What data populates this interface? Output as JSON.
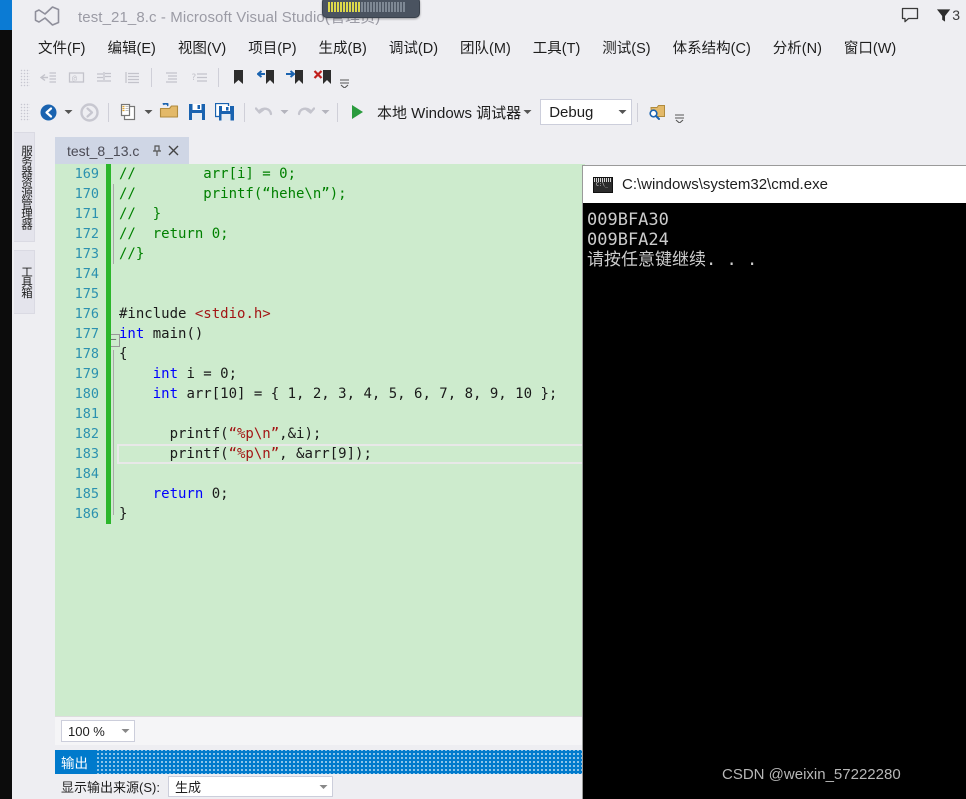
{
  "window": {
    "title": "test_21_8.c - Microsoft Visual Studio(管理员)",
    "logo_icon": "visual-studio-logo-icon",
    "perf_widget_icon": "performance-meter-icon",
    "feedback_icon": "feedback-bubble-icon",
    "notification_icon": "notification-funnel-icon",
    "notification_count": "3"
  },
  "menu": {
    "items": [
      {
        "label": "文件(F)"
      },
      {
        "label": "编辑(E)"
      },
      {
        "label": "视图(V)"
      },
      {
        "label": "项目(P)"
      },
      {
        "label": "生成(B)"
      },
      {
        "label": "调试(D)"
      },
      {
        "label": "团队(M)"
      },
      {
        "label": "工具(T)"
      },
      {
        "label": "测试(S)"
      },
      {
        "label": "体系结构(C)"
      },
      {
        "label": "分析(N)"
      },
      {
        "label": "窗口(W)"
      }
    ]
  },
  "toolbar_row1": {
    "icons": [
      {
        "name": "comment-selection-icon"
      },
      {
        "name": "uncomment-selection-icon"
      },
      {
        "name": "increase-indent-icon"
      },
      {
        "name": "decrease-indent-icon"
      },
      {
        "name": "format-document-icon"
      },
      {
        "name": "format-selection-icon"
      },
      {
        "name": "toggle-bookmark-icon"
      },
      {
        "name": "previous-bookmark-icon"
      },
      {
        "name": "next-bookmark-icon"
      },
      {
        "name": "clear-bookmarks-icon"
      },
      {
        "name": "toolbar-overflow-icon"
      }
    ]
  },
  "toolbar_row2": {
    "icons": [
      {
        "name": "navigate-backward-icon"
      },
      {
        "name": "navigate-backward-dropdown-icon"
      },
      {
        "name": "navigate-forward-icon"
      },
      {
        "name": "new-project-icon"
      },
      {
        "name": "new-project-dropdown-icon"
      },
      {
        "name": "open-file-icon"
      },
      {
        "name": "save-icon"
      },
      {
        "name": "save-all-icon"
      },
      {
        "name": "undo-icon"
      },
      {
        "name": "undo-dropdown-icon"
      },
      {
        "name": "redo-icon"
      },
      {
        "name": "redo-dropdown-icon"
      },
      {
        "name": "start-debug-icon"
      },
      {
        "name": "find-in-files-icon"
      },
      {
        "name": "toolbar-overflow-icon"
      }
    ],
    "start_label": "本地 Windows 调试器",
    "configuration": "Debug"
  },
  "left_dock": {
    "tabs": [
      {
        "label": "服务器资源管理器"
      },
      {
        "label": "工具箱"
      }
    ]
  },
  "document_tab": {
    "name": "test_8_13.c",
    "pin_icon": "pin-icon",
    "close_icon": "close-icon"
  },
  "editor": {
    "zoom": "100 %",
    "lines": [
      {
        "n": "169",
        "changed": true,
        "html": "<span class='cmt'>//        arr[i] = 0;</span>"
      },
      {
        "n": "170",
        "changed": true,
        "html": "<span class='cmt'>//        printf(“hehe\\n”);</span>"
      },
      {
        "n": "171",
        "changed": true,
        "html": "<span class='cmt'>//  }</span>"
      },
      {
        "n": "172",
        "changed": true,
        "html": "<span class='cmt'>//  return 0;</span>"
      },
      {
        "n": "173",
        "changed": true,
        "html": "<span class='cmt'>//}</span>"
      },
      {
        "n": "174",
        "changed": true,
        "html": ""
      },
      {
        "n": "175",
        "changed": true,
        "html": ""
      },
      {
        "n": "176",
        "changed": true,
        "html": "<span class='pp'>#include</span> <span class='inc'>&lt;stdio.h&gt;</span>"
      },
      {
        "n": "177",
        "changed": true,
        "html": "<span class='kw'>int</span> main()"
      },
      {
        "n": "178",
        "changed": true,
        "html": "{"
      },
      {
        "n": "179",
        "changed": true,
        "html": "    <span class='kw'>int</span> i = 0;"
      },
      {
        "n": "180",
        "changed": true,
        "html": "    <span class='kw'>int</span> arr[10] = { 1, 2, 3, 4, 5, 6, 7, 8, 9, 10 };"
      },
      {
        "n": "181",
        "changed": true,
        "html": ""
      },
      {
        "n": "182",
        "changed": true,
        "html": "      printf(<span class='str'>“%p\\n”</span>,&amp;i);"
      },
      {
        "n": "183",
        "changed": true,
        "html": "      printf(<span class='str'>“%p\\n”</span>, &amp;arr[9]);"
      },
      {
        "n": "184",
        "changed": true,
        "html": ""
      },
      {
        "n": "185",
        "changed": true,
        "html": "    <span class='kw'>return</span> 0;"
      },
      {
        "n": "186",
        "changed": true,
        "html": "}"
      }
    ]
  },
  "output_pane": {
    "title": "输出",
    "source_label": "显示输出来源(S):",
    "source_value": "生成"
  },
  "console": {
    "title": "C:\\windows\\system32\\cmd.exe",
    "icon": "cmd-console-icon",
    "lines": [
      "009BFA30",
      "009BFA24",
      "请按任意键继续. . ."
    ]
  },
  "watermark": {
    "text": "CSDN @weixin_57222280"
  },
  "colors": {
    "accent_blue": "#0b7bd4",
    "output_header": "#007acc",
    "editor_bg": "#cdebcd",
    "change_bar_green": "#2bb62b",
    "keyword_blue": "#0000ff",
    "string_red": "#a31515",
    "comment_green": "#008000",
    "lineno_teal": "#2b91af"
  }
}
